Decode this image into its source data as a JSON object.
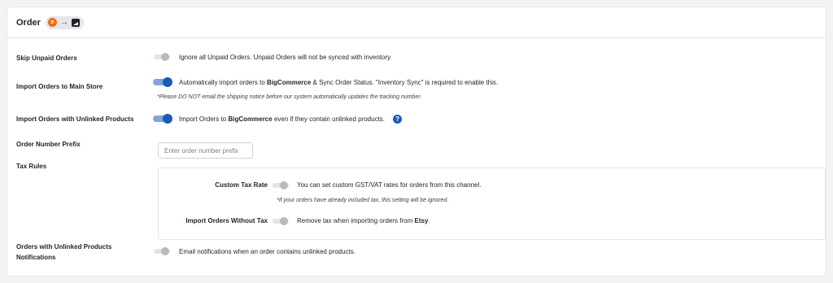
{
  "header": {
    "title": "Order",
    "source_badge": "e",
    "arrow_symbol": "→",
    "source_color": "#f26b1d",
    "target_color": "#222222"
  },
  "accent_color": "#1b5bb8",
  "settings": {
    "skip_unpaid": {
      "label": "Skip Unpaid Orders",
      "enabled": false,
      "desc": "Ignore all Unpaid Orders. Unpaid Orders will not be synced with inventory."
    },
    "import_main": {
      "label": "Import Orders to Main Store",
      "enabled": true,
      "desc_pre": "Automatically import orders to ",
      "desc_bold": "BigCommerce",
      "desc_post": " & Sync Order Status. \"Inventory Sync\" is required to enable this.",
      "note": "*Please DO NOT email the shipping notice before our system automatically updates the tracking number."
    },
    "import_unlinked": {
      "label": "Import Orders with Unlinked Products",
      "enabled": true,
      "desc_pre": "Import Orders to ",
      "desc_bold": "BigCommerce",
      "desc_post": " even if they contain unlinked products.",
      "help_symbol": "?"
    },
    "prefix": {
      "label": "Order Number Prefix",
      "placeholder": "Enter order number prefix"
    },
    "tax": {
      "label": "Tax Rules",
      "custom_rate": {
        "label": "Custom Tax Rate",
        "enabled": false,
        "desc": "You can set custom GST/VAT rates for orders from this channel.",
        "note": "*If your orders have already included tax, this setting will be ignored."
      },
      "without_tax": {
        "label": "Import Orders Without Tax",
        "enabled": false,
        "desc_pre": "Remove tax when importing orders from ",
        "desc_bold": "Etsy",
        "desc_post": "."
      }
    },
    "unlinked_notif": {
      "label_line1": "Orders with Unlinked Products",
      "label_line2": "Notifications",
      "enabled": false,
      "desc": "Email notifications when an order contains unlinked products."
    }
  }
}
